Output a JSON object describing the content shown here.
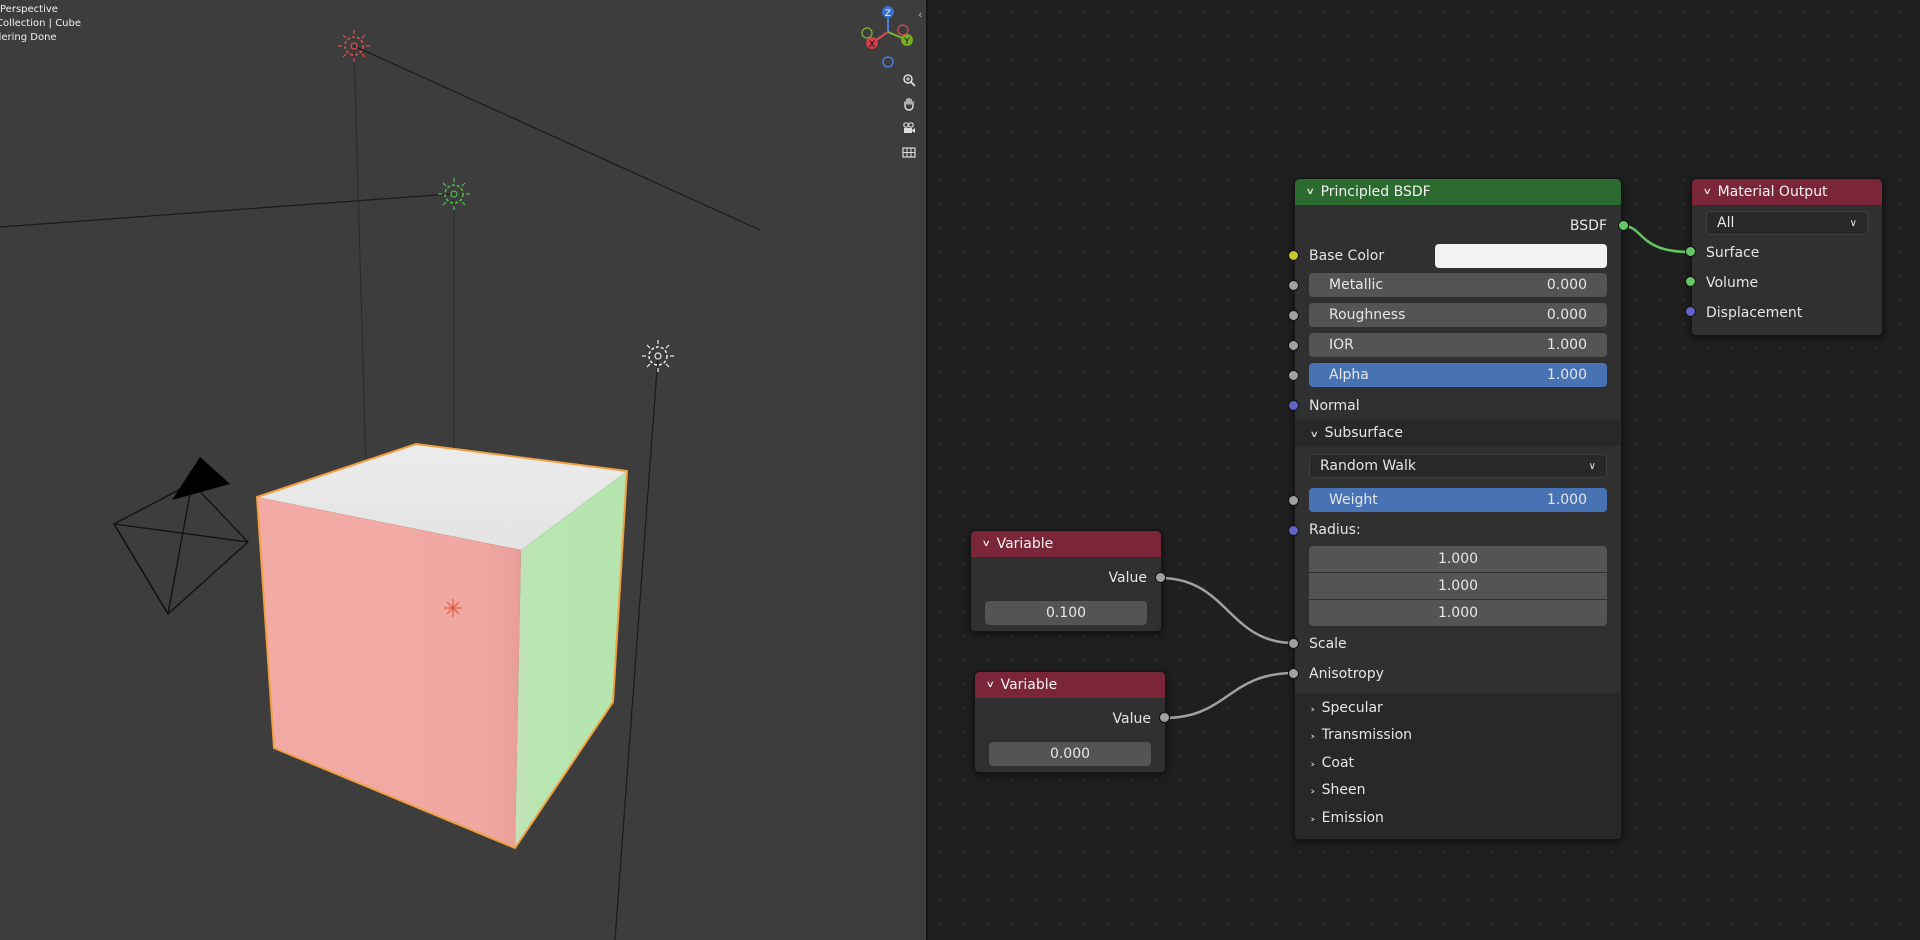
{
  "viewport": {
    "info_lines": [
      "Perspective",
      "Collection | Cube",
      "dering Done"
    ],
    "gizmo_axes": {
      "z": "Z",
      "y": "Y",
      "x": "X"
    },
    "nav_buttons": [
      "zoom-icon",
      "hand-pan-icon",
      "camera-icon",
      "grid-icon"
    ]
  },
  "node_editor": {
    "principled": {
      "title": "Principled BSDF",
      "output_label": "BSDF",
      "base_color_label": "Base Color",
      "base_color_value": "#f2f2f2",
      "metallic_label": "Metallic",
      "metallic_value": "0.000",
      "roughness_label": "Roughness",
      "roughness_value": "0.000",
      "ior_label": "IOR",
      "ior_value": "1.000",
      "alpha_label": "Alpha",
      "alpha_value": "1.000",
      "normal_label": "Normal",
      "subsurface_label": "Subsurface",
      "subsurface_method": "Random Walk",
      "weight_label": "Weight",
      "weight_value": "1.000",
      "radius_label": "Radius:",
      "radius_values": [
        "1.000",
        "1.000",
        "1.000"
      ],
      "scale_label": "Scale",
      "anisotropy_label": "Anisotropy",
      "panels": [
        "Specular",
        "Transmission",
        "Coat",
        "Sheen",
        "Emission"
      ]
    },
    "material_output": {
      "title": "Material Output",
      "target": "All",
      "inputs": [
        "Surface",
        "Volume",
        "Displacement"
      ]
    },
    "variable_1": {
      "title": "Variable",
      "output_label": "Value",
      "value": "0.100"
    },
    "variable_2": {
      "title": "Variable",
      "output_label": "Value",
      "value": "0.000"
    }
  },
  "colors": {
    "header_shader": "#2c6b2f",
    "header_output": "#7a2638",
    "field_active": "#4772b3",
    "socket_shader": "#63c763",
    "socket_float": "#a1a1a1",
    "socket_vector": "#6363c7",
    "socket_color": "#c7c729"
  }
}
